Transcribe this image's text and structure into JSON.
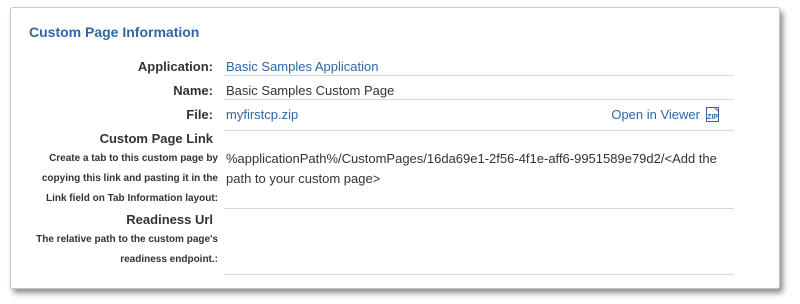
{
  "section": {
    "title": "Custom Page Information"
  },
  "fields": {
    "application": {
      "label": "Application:",
      "value": "Basic Samples Application"
    },
    "name": {
      "label": "Name:",
      "value": "Basic Samples Custom Page"
    },
    "file": {
      "label": "File:",
      "value": "myfirstcp.zip",
      "viewer_label": "Open in Viewer",
      "icon": "zip-file-icon"
    },
    "custom_page_link": {
      "label": "Custom Page Link",
      "description": "Create a tab to this custom page by copying this link and pasting it in the Link field on Tab Information layout:",
      "value": "%applicationPath%/CustomPages/16da69e1-2f56-4f1e-aff6-9951589e79d2/<Add the path to your custom page>"
    },
    "readiness_url": {
      "label": "Readiness Url",
      "description": "The relative path to the custom page's readiness endpoint.:",
      "value": ""
    }
  },
  "colors": {
    "accent": "#2f66a6",
    "text": "#333333",
    "divider": "#d9d9d9"
  }
}
